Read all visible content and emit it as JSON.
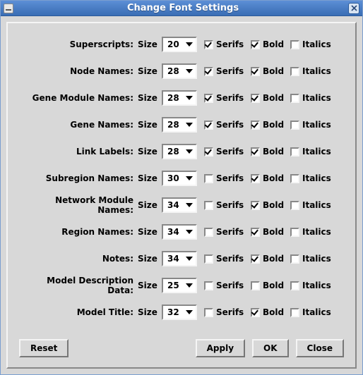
{
  "window": {
    "title": "Change Font Settings"
  },
  "labels": {
    "size": "Size",
    "serifs": "Serifs",
    "bold": "Bold",
    "italics": "Italics"
  },
  "rows": [
    {
      "label": "Superscripts:",
      "size": "20",
      "serifs": true,
      "bold": true,
      "italics": false
    },
    {
      "label": "Node Names:",
      "size": "28",
      "serifs": true,
      "bold": true,
      "italics": false
    },
    {
      "label": "Gene Module Names:",
      "size": "28",
      "serifs": true,
      "bold": true,
      "italics": false
    },
    {
      "label": "Gene Names:",
      "size": "28",
      "serifs": true,
      "bold": true,
      "italics": false
    },
    {
      "label": "Link Labels:",
      "size": "28",
      "serifs": true,
      "bold": true,
      "italics": false
    },
    {
      "label": "Subregion Names:",
      "size": "30",
      "serifs": false,
      "bold": true,
      "italics": false
    },
    {
      "label": "Network Module Names:",
      "size": "34",
      "serifs": false,
      "bold": true,
      "italics": false
    },
    {
      "label": "Region Names:",
      "size": "34",
      "serifs": false,
      "bold": true,
      "italics": false
    },
    {
      "label": "Notes:",
      "size": "34",
      "serifs": false,
      "bold": true,
      "italics": false
    },
    {
      "label": "Model Description Data:",
      "size": "25",
      "serifs": false,
      "bold": false,
      "italics": false
    },
    {
      "label": "Model Title:",
      "size": "32",
      "serifs": false,
      "bold": true,
      "italics": false
    }
  ],
  "buttons": {
    "reset": "Reset",
    "apply": "Apply",
    "ok": "OK",
    "close": "Close"
  }
}
